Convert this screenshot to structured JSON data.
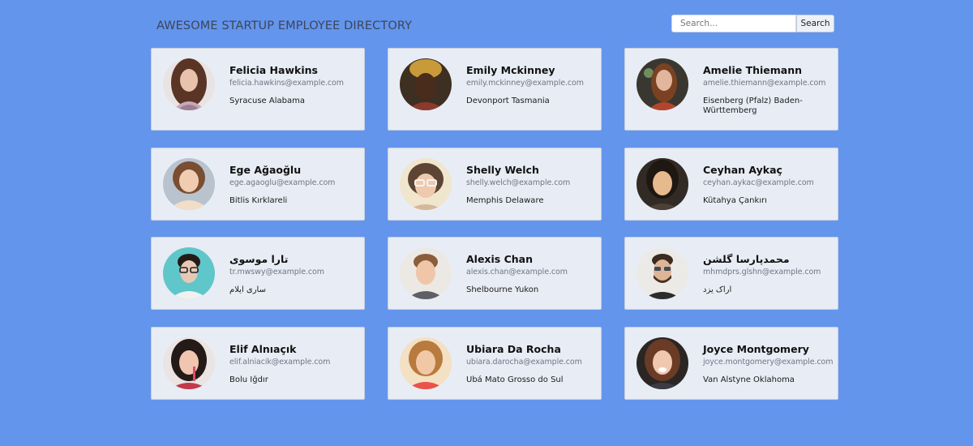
{
  "header": {
    "title": "AWESOME STARTUP EMPLOYEE DIRECTORY",
    "search_placeholder": "Search...",
    "search_button_label": "Search"
  },
  "colors": {
    "background": "#6495ED",
    "card_background": "#e8ecf4"
  },
  "employees": [
    {
      "name": "Felicia Hawkins",
      "email": "felicia.hawkins@example.com",
      "location": "Syracuse Alabama",
      "photo": "woman-portrait"
    },
    {
      "name": "Emily Mckinney",
      "email": "emily.mckinney@example.com",
      "location": "Devonport Tasmania",
      "photo": "woman-portrait"
    },
    {
      "name": "Amelie Thiemann",
      "email": "amelie.thiemann@example.com",
      "location": "Eisenberg (Pfalz) Baden-Württemberg",
      "photo": "woman-portrait"
    },
    {
      "name": "Ege Ağaoğlu",
      "email": "ege.agaoglu@example.com",
      "location": "Bitlis Kırklareli",
      "photo": "woman-portrait"
    },
    {
      "name": "Shelly Welch",
      "email": "shelly.welch@example.com",
      "location": "Memphis Delaware",
      "photo": "woman-portrait"
    },
    {
      "name": "Ceyhan Aykaç",
      "email": "ceyhan.aykac@example.com",
      "location": "Kütahya Çankırı",
      "photo": "woman-portrait"
    },
    {
      "name": "تارا موسوی",
      "email": "tr.mwswy@example.com",
      "location": "ساری ایلام",
      "photo": "person-portrait"
    },
    {
      "name": "Alexis Chan",
      "email": "alexis.chan@example.com",
      "location": "Shelbourne Yukon",
      "photo": "man-portrait"
    },
    {
      "name": "محمدپارسا گلشن",
      "email": "mhmdprs.glshn@example.com",
      "location": "اراک یزد",
      "photo": "man-portrait"
    },
    {
      "name": "Elif Alnıaçık",
      "email": "elif.alniacik@example.com",
      "location": "Bolu Iğdır",
      "photo": "woman-portrait"
    },
    {
      "name": "Ubiara Da Rocha",
      "email": "ubiara.darocha@example.com",
      "location": "Ubá Mato Grosso do Sul",
      "photo": "woman-portrait"
    },
    {
      "name": "Joyce Montgomery",
      "email": "joyce.montgomery@example.com",
      "location": "Van Alstyne Oklahoma",
      "photo": "woman-portrait"
    }
  ]
}
